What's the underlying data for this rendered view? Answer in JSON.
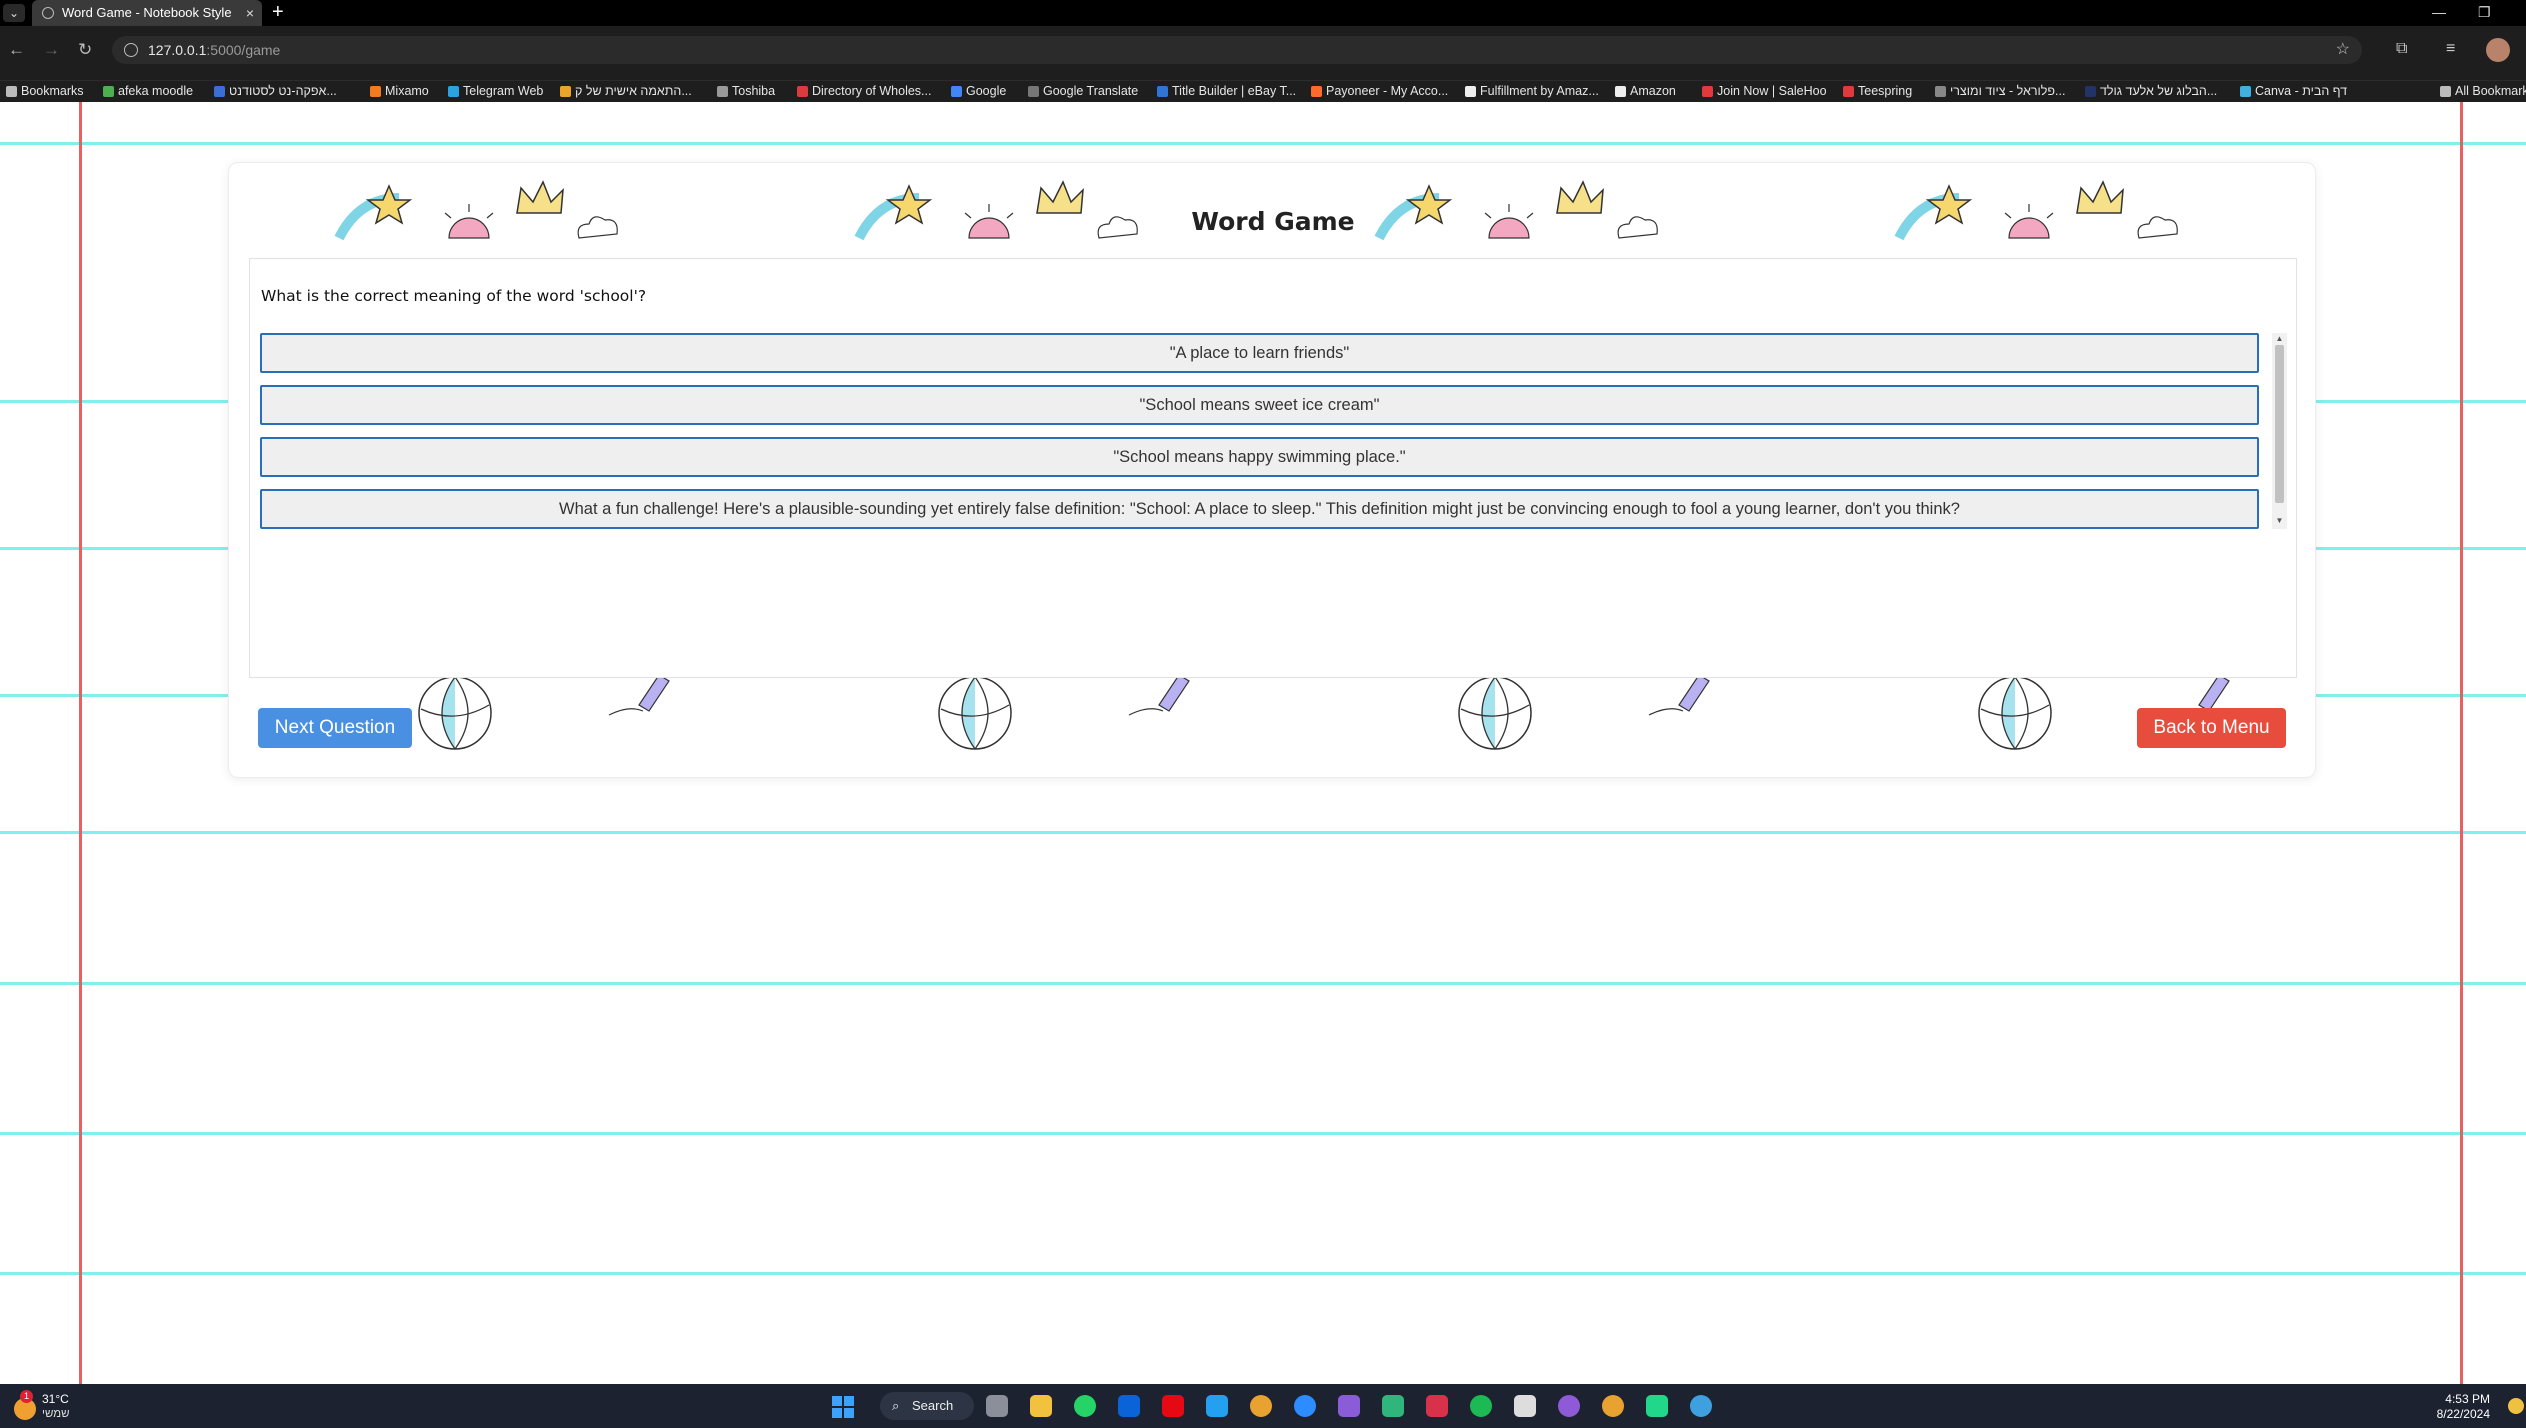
{
  "browser": {
    "tab_title": "Word Game - Notebook Style",
    "tab_close": "×",
    "new_tab": "+",
    "url_host": "127.0.0.1",
    "url_path": ":5000/game",
    "bookmarks": [
      {
        "label": "Bookmarks",
        "color": "#bbbbbb"
      },
      {
        "label": "afeka moodle",
        "color": "#4caf50"
      },
      {
        "label": "אפקה-נט לסטודנט...",
        "color": "#3b6fd6"
      },
      {
        "label": "Mixamo",
        "color": "#f47c20"
      },
      {
        "label": "Telegram Web",
        "color": "#2aa3e0"
      },
      {
        "label": "התאמה אישית של ק...",
        "color": "#e8a52a"
      },
      {
        "label": "Toshiba",
        "color": "#999999"
      },
      {
        "label": "Directory of Wholes...",
        "color": "#d93c3c"
      },
      {
        "label": "Google",
        "color": "#4285f4"
      },
      {
        "label": "Google Translate",
        "color": "#777777"
      },
      {
        "label": "Title Builder | eBay T...",
        "color": "#2f75d6"
      },
      {
        "label": "Payoneer - My Acco...",
        "color": "#ff6b2d"
      },
      {
        "label": "Fulfillment by Amaz...",
        "color": "#eeeeee"
      },
      {
        "label": "Amazon",
        "color": "#eeeeee"
      },
      {
        "label": "Join Now | SaleHoo",
        "color": "#e0393e"
      },
      {
        "label": "Teespring",
        "color": "#e0393e"
      },
      {
        "label": "פלוראל - ציוד ומוצרי...",
        "color": "#888888"
      },
      {
        "label": "הבלוג של אלעד גולד...",
        "color": "#223366"
      },
      {
        "label": "Canva - דף הבית",
        "color": "#3fb0e0"
      },
      {
        "label": "All Bookmarks",
        "color": "#bbbbbb"
      }
    ]
  },
  "game": {
    "title": "Word Game",
    "question": "What is the correct meaning of the word 'school'?",
    "answers": [
      "\"A place to learn friends\"",
      "\"School means sweet ice cream\"",
      "\"School means happy swimming place.\"",
      "What a fun challenge! Here's a plausible-sounding yet entirely false definition: \"School: A place to sleep.\" This definition might just be convincing enough to fool a young learner, don't you think?"
    ],
    "next_button": "Next Question",
    "back_button": "Back to Menu",
    "colors": {
      "next": "#4a90e2",
      "back": "#e74c3c",
      "answer_border": "#2a6db8",
      "ruled_line": "#7ff0ee",
      "margin_line": "#e86060"
    }
  },
  "taskbar": {
    "weather_temp": "31°C",
    "weather_desc": "שמשי",
    "weather_badge": "1",
    "search_label": "Search",
    "time": "4:53 PM",
    "date": "8/22/2024"
  }
}
